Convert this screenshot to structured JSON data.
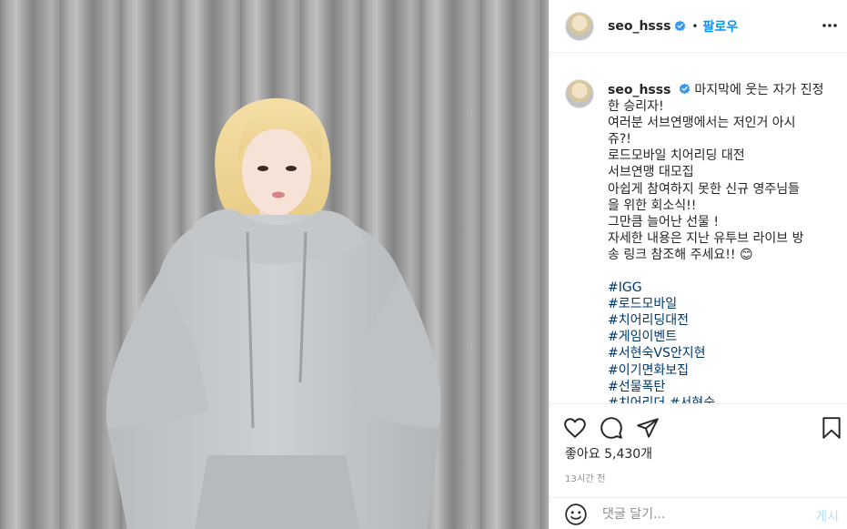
{
  "header": {
    "username": "seo_hsss",
    "separator": "•",
    "follow_label": "팔로우"
  },
  "caption": {
    "username": "seo_hsss",
    "lines": [
      "마지막에 웃는 자가 진정",
      "한 승리자!",
      "여러분 서브연맹에서는 저인거 아시",
      "쥬?!",
      "로드모바일 치어리딩 대전",
      "서브연맹 대모집",
      "아쉽게 참여하지 못한 신규 영주님들",
      "을 위한 회소식!!",
      "그만큼 늘어난 선물 !",
      "자세한 내용은 지난 유투브 라이브 방",
      "송 링크 참조해 주세요!! 😊"
    ],
    "hashtags": [
      "#IGG",
      "#로드모바일",
      "#치어리딩대전",
      "#게임이벤트",
      "#서현숙VS안지현",
      "#이기면화보집",
      "#선물폭탄",
      "#치어리더 #서현숙"
    ]
  },
  "actions": {
    "likes_text": "좋아요 5,430개",
    "time_text": "13시간 전"
  },
  "comment": {
    "placeholder": "댓글 달기...",
    "post_label": "게시"
  },
  "icons": {
    "verified": "verified-badge-icon",
    "more": "more-options-icon",
    "like": "heart-icon",
    "comment": "comment-bubble-icon",
    "share": "paper-plane-icon",
    "save": "bookmark-icon",
    "emoji": "smiley-icon"
  },
  "colors": {
    "link_blue": "#0095f6",
    "hashtag": "#00376b",
    "muted": "#8e8e8e",
    "verified": "#3897f0",
    "post_disabled": "#b2dffc"
  }
}
